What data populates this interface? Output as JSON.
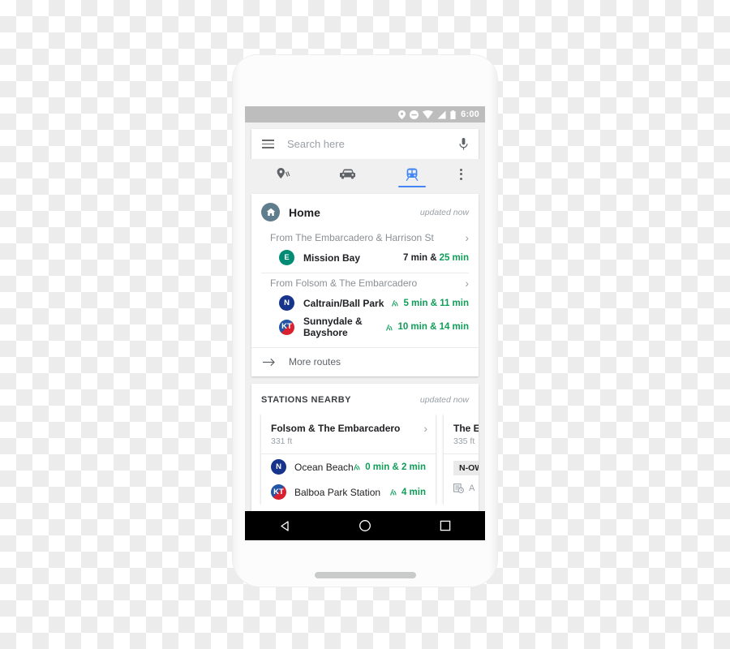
{
  "statusbar": {
    "time": "6:00",
    "icons": [
      "location-pin-icon",
      "do-not-disturb-icon",
      "wifi-icon",
      "cell-signal-icon",
      "battery-icon"
    ]
  },
  "search": {
    "placeholder": "Search here",
    "menu_icon": "hamburger-menu-icon",
    "mic_icon": "microphone-icon"
  },
  "tabs": [
    {
      "name": "tab-explore",
      "icon": "explore-pin-icon",
      "active": false
    },
    {
      "name": "tab-driving",
      "icon": "car-icon",
      "active": false
    },
    {
      "name": "tab-transit",
      "icon": "train-icon",
      "active": true
    },
    {
      "name": "tab-overflow",
      "icon": "more-vertical-icon",
      "active": false
    }
  ],
  "home_card": {
    "icon": "home-icon",
    "title": "Home",
    "updated": "updated now",
    "groups": [
      {
        "from": "From The Embarcadero & Harrison St",
        "routes": [
          {
            "line": "E",
            "line_style": "badge-E",
            "name": "Mission Bay",
            "time_plain": "7 min &",
            "time_green": "25 min",
            "live": false
          }
        ]
      },
      {
        "from": "From Folsom & The Embarcadero",
        "routes": [
          {
            "line": "N",
            "line_style": "badge-N",
            "name": "Caltrain/Ball Park",
            "time_green_all": "5 min & 11 min",
            "live": true
          },
          {
            "line": "KT",
            "line_style": "badge-KT",
            "name": "Sunnydale & Bayshore",
            "time_green_all": "10 min & 14 min",
            "live": true
          }
        ]
      }
    ],
    "more_routes": {
      "label": "More routes",
      "icon": "arrow-right-icon"
    }
  },
  "stations_nearby": {
    "title": "STATIONS NEARBY",
    "updated": "updated now",
    "stations": [
      {
        "name": "Folsom & The Embarcadero",
        "distance": "331 ft",
        "chevron": "chevron-right-icon",
        "lines": [
          {
            "line": "N",
            "line_style": "badge-N",
            "name": "Ocean Beach",
            "time_green_all": "0 min & 2 min",
            "live": true
          },
          {
            "line": "KT",
            "line_style": "badge-KT",
            "name": "Balboa Park Station",
            "time_green_all": "4 min",
            "live": true
          }
        ]
      },
      {
        "name": "The Em",
        "distance": "335 ft",
        "badge": "N-OW",
        "schedule_icon": "schedule-icon",
        "schedule_text": "A",
        "partial": true
      }
    ]
  },
  "navbar": {
    "buttons": [
      {
        "name": "nav-back-button",
        "icon": "back-triangle-icon"
      },
      {
        "name": "nav-home-button",
        "icon": "home-circle-icon"
      },
      {
        "name": "nav-recents-button",
        "icon": "recents-square-icon"
      }
    ]
  }
}
